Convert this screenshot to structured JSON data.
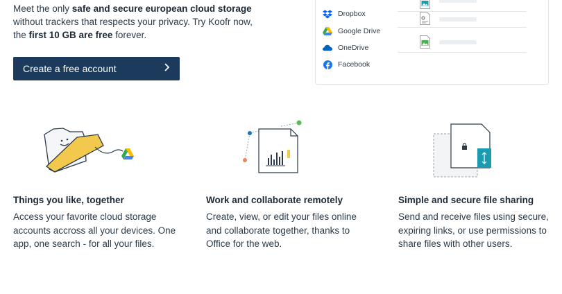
{
  "hero": {
    "line1_pre": "Meet the only ",
    "line1_bold": "safe and secure european cloud storage",
    "line2": "without trackers that respects your privacy. Try Koofr now,",
    "line3_pre": "the ",
    "line3_bold": "first 10 GB are free",
    "line3_post": " forever.",
    "cta_label": "Create a free account",
    "cta_icon": "chevron-right-icon"
  },
  "services": [
    {
      "label": "Dropbox",
      "icon": "dropbox-icon",
      "color": "#0061fe"
    },
    {
      "label": "Google Drive",
      "icon": "google-drive-icon",
      "color": "#34a853"
    },
    {
      "label": "OneDrive",
      "icon": "onedrive-icon",
      "color": "#0364b8"
    },
    {
      "label": "Facebook",
      "icon": "facebook-icon",
      "color": "#1877f2"
    }
  ],
  "features": [
    {
      "title": "Things you like, together",
      "text": "Access your favorite cloud storage accounts accross all your devices. One app, one search - for all your files."
    },
    {
      "title": "Work and collaborate remotely",
      "text": "Create, view, or edit your files online and collaborate together, thanks to Office for the web."
    },
    {
      "title": "Simple and secure file sharing",
      "text": "Send and receive files using secure, expiring links, or use permissions to share files with other users."
    }
  ],
  "colors": {
    "brand_dark": "#1b3a5c",
    "accent_teal": "#1a9bb0",
    "accent_yellow": "#f2c94c"
  }
}
